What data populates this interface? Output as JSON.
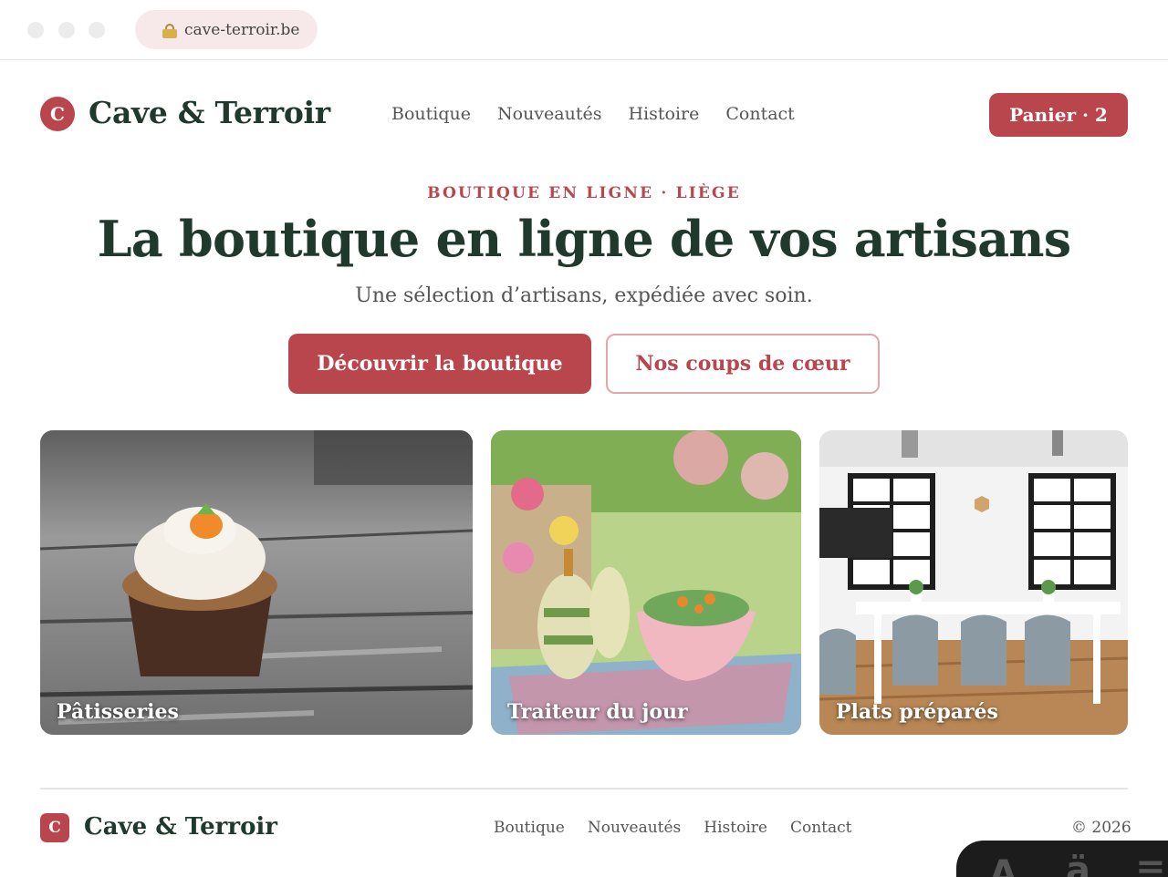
{
  "browser": {
    "url": "cave-terroir.be"
  },
  "header": {
    "logo_letter": "C",
    "brand": "Cave & Terroir",
    "nav": [
      "Boutique",
      "Nouveautés",
      "Histoire",
      "Contact"
    ],
    "cart_label": "Panier · 2"
  },
  "hero": {
    "eyebrow": "BOUTIQUE EN LIGNE · LIÈGE",
    "title": "La boutique en ligne de vos artisans",
    "subtitle": "Une sélection d’artisans, expédiée avec soin.",
    "primary_cta": "Découvrir la boutique",
    "secondary_cta": "Nos coups de cœur"
  },
  "cards": [
    {
      "label": "Pâtisseries"
    },
    {
      "label": "Traiteur du jour"
    },
    {
      "label": "Plats préparés"
    }
  ],
  "footer": {
    "logo_letter": "C",
    "brand": "Cave & Terroir",
    "nav": [
      "Boutique",
      "Nouveautés",
      "Histoire",
      "Contact"
    ],
    "copyright": "© 2026"
  },
  "colors": {
    "accent": "#b9464d",
    "brand_green": "#1f3a2c",
    "accent_light": "#e2a7ab"
  }
}
